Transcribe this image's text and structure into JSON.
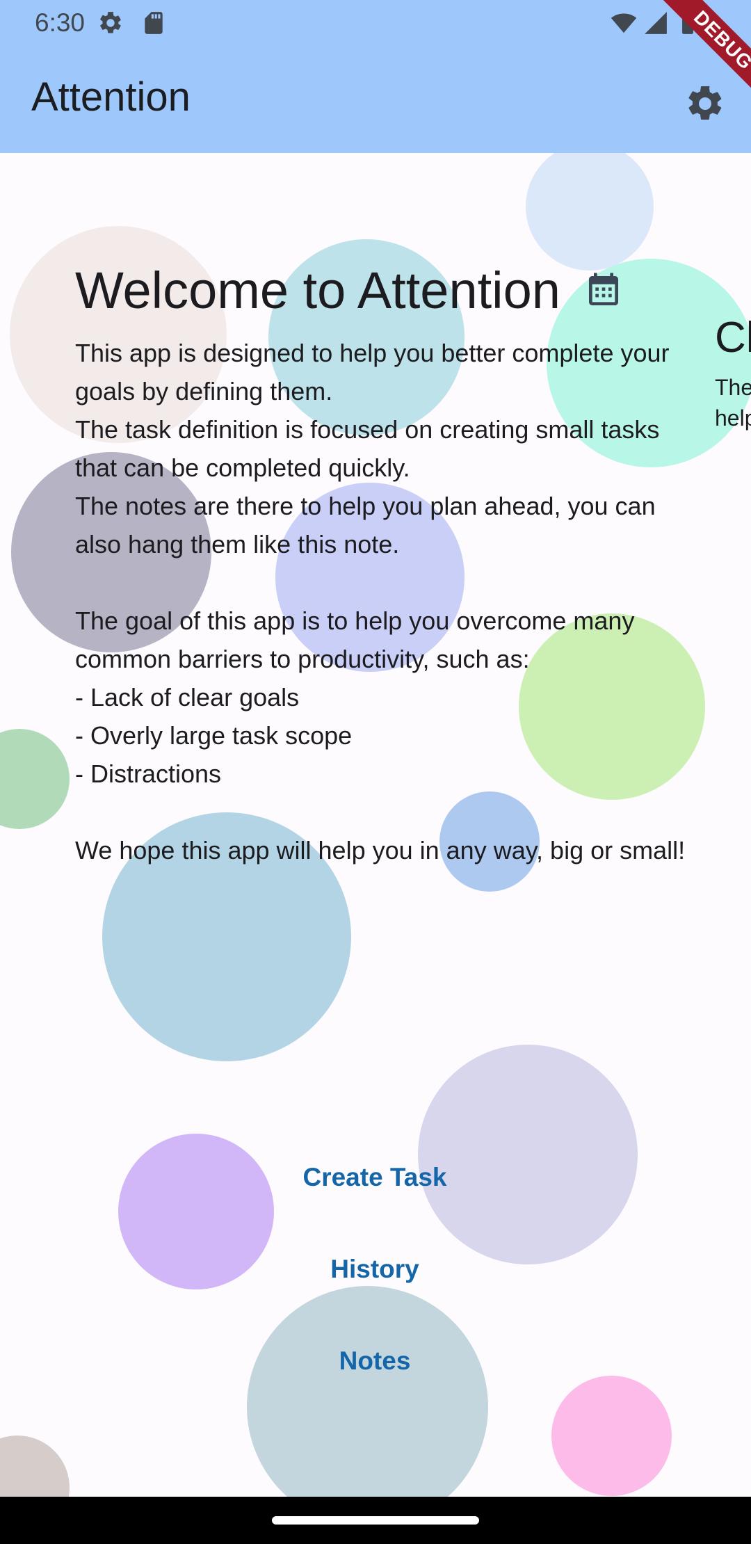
{
  "status_bar": {
    "time": "6:30",
    "icons": [
      "settings-gear-icon",
      "sd-card-icon",
      "wifi-icon",
      "signal-icon",
      "battery-icon"
    ]
  },
  "app_bar": {
    "title": "Attention",
    "settings_icon": "gear-icon",
    "background": "#9ec7fc"
  },
  "debug_banner": "DEBUG",
  "welcome_note": {
    "title": "Welcome to Attention",
    "icon": "calendar-icon",
    "body": "This app is designed to help you better complete your goals by defining them.\nThe task definition is focused on creating small tasks that can be completed quickly.\nThe notes are there to help you plan ahead, you can also hang them like this note.\n\nThe goal of this app is to help you overcome many common barriers to productivity, such as:\n- Lack of clear goals\n- Overly large task scope\n- Distractions\n\nWe hope this app will help you in any way, big or small!"
  },
  "side_note": {
    "title": "Cl",
    "body": "The\nhelp"
  },
  "nav": {
    "create_task": "Create Task",
    "history": "History",
    "notes": "Notes",
    "link_color": "#1466a8"
  }
}
